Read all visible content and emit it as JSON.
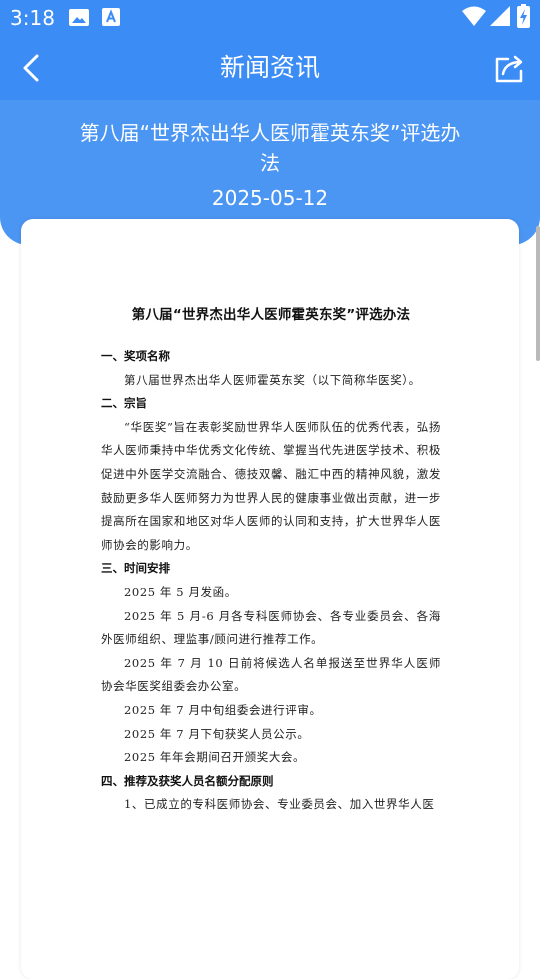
{
  "status_bar": {
    "time": "3:18",
    "icons": [
      "image-icon",
      "text-a-icon",
      "wifi-icon",
      "cellular-signal-icon",
      "battery-charging-icon"
    ]
  },
  "app_bar": {
    "title": "新闻资讯",
    "icons": [
      "back-chevron-icon",
      "share-icon"
    ]
  },
  "article": {
    "title": "第八届“世界杰出华人医师霍英东奖”评选办法",
    "date": "2025-05-12"
  },
  "document": {
    "title": "第八届“世界杰出华人医师霍英东奖”评选办法",
    "blocks": [
      {
        "type": "heading",
        "text": "一、奖项名称"
      },
      {
        "type": "para",
        "text": "第八届世界杰出华人医师霍英东奖（以下简称华医奖）。"
      },
      {
        "type": "heading",
        "text": "二、宗旨"
      },
      {
        "type": "para",
        "text": "“华医奖”旨在表彰奖励世界华人医师队伍的优秀代表，弘扬华人医师秉持中华优秀文化传统、掌握当代先进医学技术、积极促进中外医学交流融合、德技双馨、融汇中西的精神风貌，激发鼓励更多华人医师努力为世界人民的健康事业做出贡献，进一步提高所在国家和地区对华人医师的认同和支持，扩大世界华人医师协会的影响力。"
      },
      {
        "type": "heading",
        "text": "三、时间安排"
      },
      {
        "type": "line",
        "text": "2025 年 5 月发函。"
      },
      {
        "type": "para",
        "text": "2025 年 5 月-6 月各专科医师协会、各专业委员会、各海外医师组织、理监事/顾问进行推荐工作。"
      },
      {
        "type": "para",
        "text": "2025 年 7 月 10 日前将候选人名单报送至世界华人医师协会华医奖组委会办公室。"
      },
      {
        "type": "line",
        "text": "2025 年 7 月中旬组委会进行评审。"
      },
      {
        "type": "line",
        "text": "2025 年 7 月下旬获奖人员公示。"
      },
      {
        "type": "line",
        "text": "2025 年年会期间召开颁奖大会。"
      },
      {
        "type": "heading",
        "text": "四、推荐及获奖人员名额分配原则"
      },
      {
        "type": "line",
        "text": "1、已成立的专科医师协会、专业委员会、加入世界华人医"
      }
    ]
  }
}
